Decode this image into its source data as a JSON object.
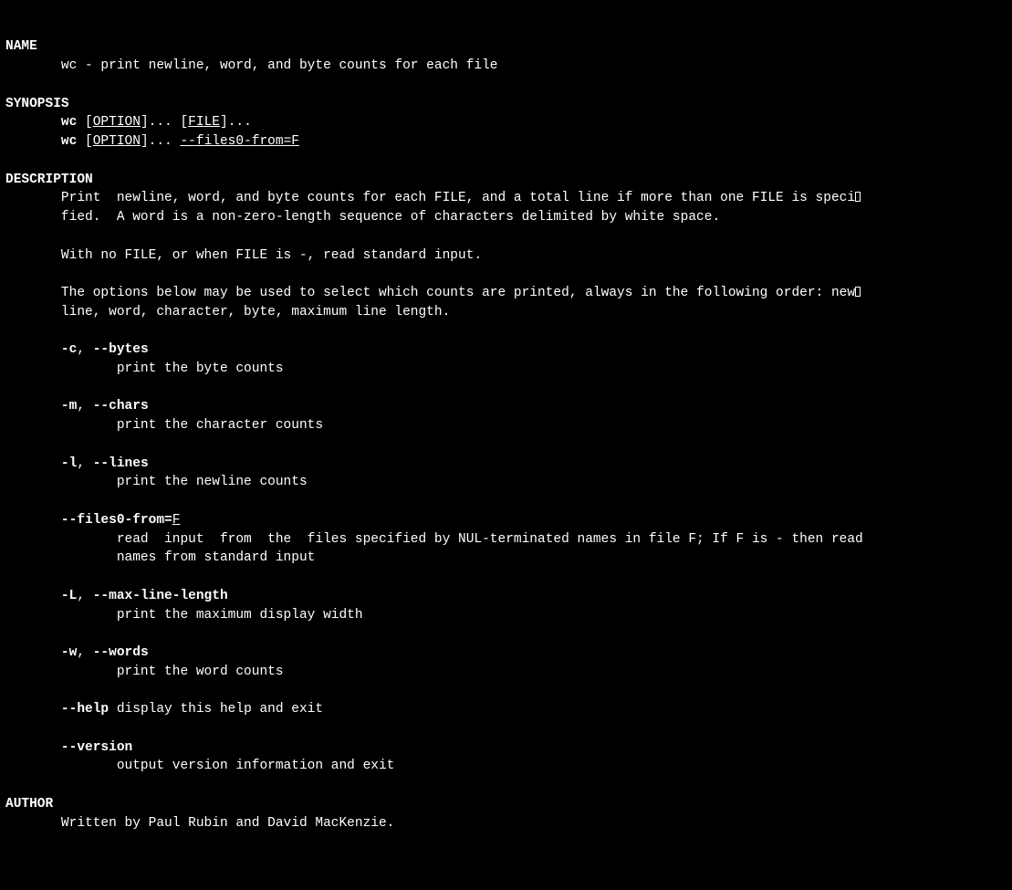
{
  "sections": {
    "name": {
      "heading": "NAME",
      "text": "wc - print newline, word, and byte counts for each file"
    },
    "synopsis": {
      "heading": "SYNOPSIS",
      "cmd": "wc",
      "option_placeholder": "OPTION",
      "file_placeholder": "FILE",
      "files0_flag": "--files0-from=",
      "files0_arg": "F",
      "dots": "..."
    },
    "description": {
      "heading": "DESCRIPTION",
      "para1_a": "Print  newline, word, and byte counts for each FILE, and a total line if more than one FILE is speci",
      "para1_b": "fied.  A word is a non-zero-length sequence of characters delimited by white space.",
      "para2": "With no FILE, or when FILE is -, read standard input.",
      "para3_a": "The options below may be used to select which counts are printed, always in the following order: new",
      "para3_b": "line, word, character, byte, maximum line length.",
      "options": {
        "bytes": {
          "short": "-c",
          "long": "--bytes",
          "desc": "print the byte counts"
        },
        "chars": {
          "short": "-m",
          "long": "--chars",
          "desc": "print the character counts"
        },
        "lines": {
          "short": "-l",
          "long": "--lines",
          "desc": "print the newline counts"
        },
        "files0": {
          "long": "--files0-from=",
          "arg": "F",
          "desc_a": "read  input  from  the  files specified by NUL-terminated names in file F; If F is - then read",
          "desc_b": "names from standard input"
        },
        "maxline": {
          "short": "-L",
          "long": "--max-line-length",
          "desc": "print the maximum display width"
        },
        "words": {
          "short": "-w",
          "long": "--words",
          "desc": "print the word counts"
        },
        "help": {
          "long": "--help",
          "desc": "display this help and exit"
        },
        "version": {
          "long": "--version",
          "desc": "output version information and exit"
        }
      }
    },
    "author": {
      "heading": "AUTHOR",
      "text": "Written by Paul Rubin and David MacKenzie."
    }
  },
  "sep": ", "
}
